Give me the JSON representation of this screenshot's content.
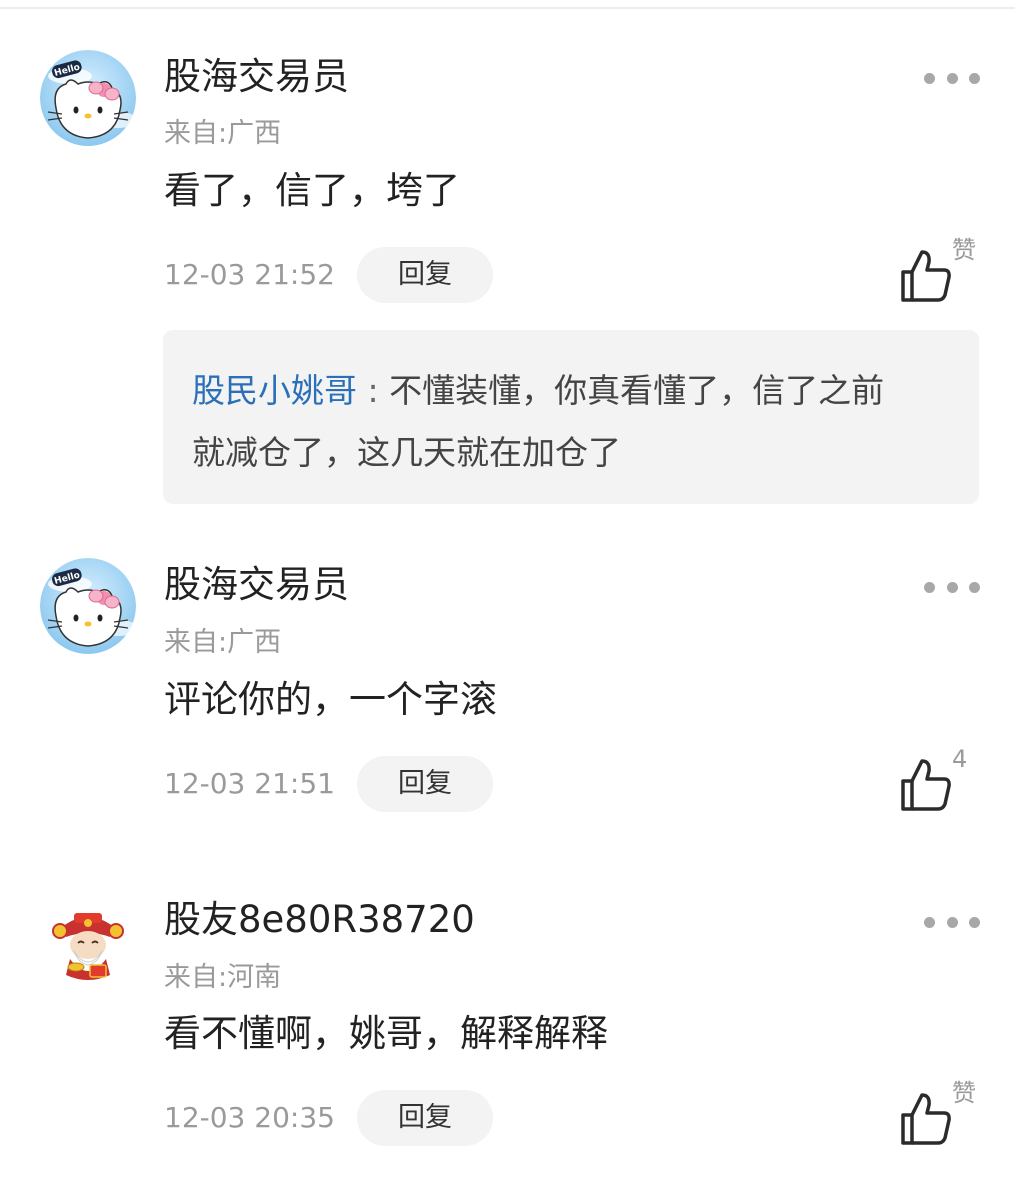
{
  "comments": [
    {
      "username": "股海交易员",
      "location": "来自:广西",
      "content": "看了，信了，垮了",
      "time": "12-03 21:52",
      "reply_label": "回复",
      "like_label": "赞",
      "avatar_text": "Hello",
      "reply": {
        "author": "股民小姚哥",
        "separator": " : ",
        "line1": "不懂装懂，你真看懂了，信了之前",
        "line2": "就减仓了，这几天就在加仓了"
      }
    },
    {
      "username": "股海交易员",
      "location": "来自:广西",
      "content": "评论你的，一个字滚",
      "time": "12-03 21:51",
      "reply_label": "回复",
      "like_label": "4",
      "avatar_text": "Hello"
    },
    {
      "username": "股友8e80R38720",
      "location": "来自:河南",
      "content": "看不懂啊，姚哥，解释解释",
      "time": "12-03 20:35",
      "reply_label": "回复",
      "like_label": "赞"
    }
  ],
  "icons": {
    "more": "more-horizontal-icon",
    "like": "thumbs-up-icon"
  },
  "colors": {
    "reply_author": "#2a6fb8",
    "secondary_text": "#9a9a9a",
    "primary_text": "#222222",
    "pill_background": "#f3f3f3"
  }
}
